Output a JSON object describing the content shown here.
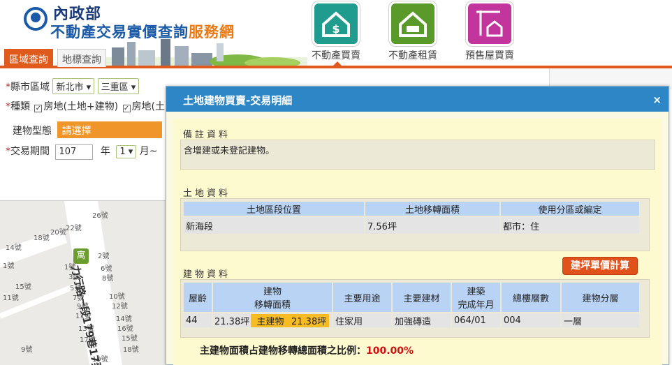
{
  "header": {
    "ministry": "內政部",
    "site_title_main": "不動產交易實價查詢",
    "site_title_highlight": "服務網",
    "nav": [
      {
        "label": "不動產買賣",
        "icon": "house-dollar-icon",
        "color": "#1f9c8e"
      },
      {
        "label": "不動產租賃",
        "icon": "house-rent-icon",
        "color": "#5a9a2a"
      },
      {
        "label": "預售屋買賣",
        "icon": "presale-crane-icon",
        "color": "#c2359c"
      }
    ]
  },
  "tabs": {
    "area_query": "區域查詢",
    "landmark_query": "地標查詢"
  },
  "search": {
    "region_label": "縣市區域",
    "city_value": "新北市",
    "district_value": "三重區",
    "type_label": "種類",
    "type_option1": "房地(土地+建物)",
    "type_option2": "房地(土",
    "building_type_label": "建物型態",
    "building_type_placeholder": "請選擇",
    "period_label": "交易期間",
    "year_value": "107",
    "year_unit": "年",
    "month_value": "1",
    "month_unit": "月~"
  },
  "map": {
    "poi_label": "寓",
    "road_label": "力行路一段179巷17弄",
    "labels": [
      "26號",
      "22號",
      "20號",
      "18號",
      "14號",
      "2號",
      "1號",
      "6號",
      "3號",
      "8號",
      "15號",
      "5號",
      "7號",
      "10號",
      "9號",
      "12號",
      "11號",
      "14號",
      "13號",
      "16號",
      "15號",
      "18號",
      "17號",
      "9號",
      "19號",
      "1號",
      "11號"
    ]
  },
  "dialog": {
    "title": "土地建物買賣-交易明細",
    "close": "×",
    "notes_title": "備註資料",
    "notes_text": "含增建或未登記建物。",
    "land_title": "土地資料",
    "land_headers": [
      "土地區段位置",
      "土地移轉面積",
      "使用分區或編定"
    ],
    "land_row": [
      "新海段",
      "7.56坪",
      "都市：住"
    ],
    "calc_button": "建坪單價計算",
    "building_title": "建物資料",
    "building_headers": [
      "屋齡",
      "建物\n移轉面積",
      "主要用途",
      "主要建材",
      "建築\n完成年月",
      "總樓層數",
      "建物分層"
    ],
    "building_row": {
      "age": "44",
      "transfer_area": "21.38坪",
      "main_building_label": "主建物",
      "main_building_area": "21.38坪",
      "main_use": "住家用",
      "main_material": "加強磚造",
      "completed": "064/01",
      "total_floors": "004",
      "floor": "一層"
    },
    "ratio_label": "主建物面積占建物移轉總面積之比例：",
    "ratio_value": "100.00%"
  }
}
